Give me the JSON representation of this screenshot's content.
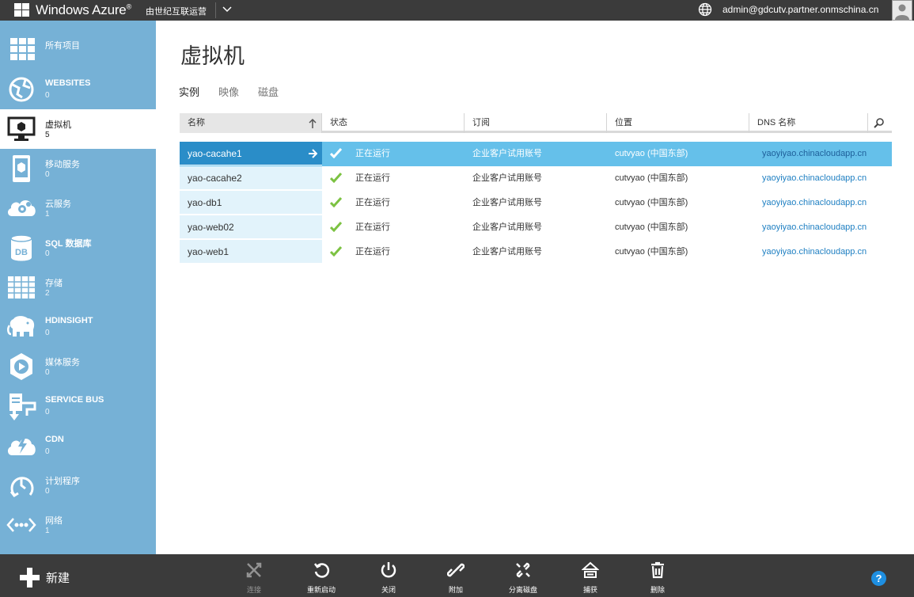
{
  "topbar": {
    "brand": "Windows Azure",
    "brand_mark": "®",
    "operator": "由世纪互联运营",
    "user": "admin@gdcutv.partner.onmschina.cn"
  },
  "sidebar": {
    "items": [
      {
        "label": "所有项目",
        "count": ""
      },
      {
        "label": "WEBSITES",
        "count": "0"
      },
      {
        "label": "虚拟机",
        "count": "5"
      },
      {
        "label": "移动服务",
        "count": "0"
      },
      {
        "label": "云服务",
        "count": "1"
      },
      {
        "label": "SQL 数据库",
        "count": "0"
      },
      {
        "label": "存储",
        "count": "2"
      },
      {
        "label": "HDINSIGHT",
        "count": "0"
      },
      {
        "label": "媒体服务",
        "count": "0"
      },
      {
        "label": "SERVICE BUS",
        "count": "0"
      },
      {
        "label": "CDN",
        "count": "0"
      },
      {
        "label": "计划程序",
        "count": "0"
      },
      {
        "label": "网络",
        "count": "1"
      }
    ]
  },
  "main": {
    "title": "虚拟机",
    "tabs": [
      "实例",
      "映像",
      "磁盘"
    ],
    "columns": [
      "名称",
      "状态",
      "订阅",
      "位置",
      "DNS 名称"
    ],
    "rows": [
      {
        "name": "yao-cacahe1",
        "status": "正在运行",
        "subscription": "企业客户试用账号",
        "location": "cutvyao (中国东部)",
        "dns": "yaoyiyao.chinacloudapp.cn"
      },
      {
        "name": "yao-cacahe2",
        "status": "正在运行",
        "subscription": "企业客户试用账号",
        "location": "cutvyao (中国东部)",
        "dns": "yaoyiyao.chinacloudapp.cn"
      },
      {
        "name": "yao-db1",
        "status": "正在运行",
        "subscription": "企业客户试用账号",
        "location": "cutvyao (中国东部)",
        "dns": "yaoyiyao.chinacloudapp.cn"
      },
      {
        "name": "yao-web02",
        "status": "正在运行",
        "subscription": "企业客户试用账号",
        "location": "cutvyao (中国东部)",
        "dns": "yaoyiyao.chinacloudapp.cn"
      },
      {
        "name": "yao-web1",
        "status": "正在运行",
        "subscription": "企业客户试用账号",
        "location": "cutvyao (中国东部)",
        "dns": "yaoyiyao.chinacloudapp.cn"
      }
    ]
  },
  "cmdbar": {
    "new_label": "新建",
    "commands": [
      "连接",
      "重新启动",
      "关闭",
      "附加",
      "分离磁盘",
      "捕获",
      "删除"
    ],
    "help": "?"
  },
  "colors": {
    "topbar": "#3b3b3b",
    "sidebar": "#76b1d6",
    "selected_row": "#65c0ea",
    "selected_name": "#2a8dc8",
    "link": "#1e7fc2",
    "check": "#7cc242"
  }
}
